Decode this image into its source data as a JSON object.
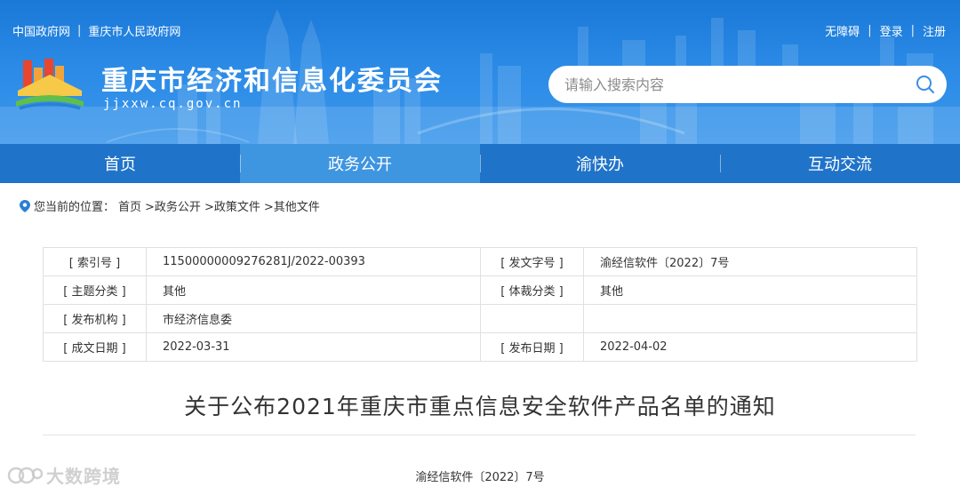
{
  "top_links": {
    "left": [
      "中国政府网",
      "重庆市人民政府网"
    ],
    "separator": "|",
    "right": [
      "无障碍",
      "登录",
      "注册"
    ]
  },
  "site": {
    "title": "重庆市经济和信息化委员会",
    "domain": "jjxxw.cq.gov.cn"
  },
  "search": {
    "placeholder": "请输入搜索内容",
    "icon": "search-icon"
  },
  "nav": {
    "items": [
      "首页",
      "政务公开",
      "渝快办",
      "互动交流"
    ],
    "active_index": 1
  },
  "breadcrumb": {
    "prefix": "您当前的位置：",
    "items": [
      "首页",
      ">政务公开",
      ">政策文件",
      ">其他文件"
    ],
    "icon": "location-pin-icon"
  },
  "meta_table": {
    "rows": [
      {
        "label1": "[ 索引号 ]",
        "value1": "11500000009276281J/2022-00393",
        "label2": "[ 发文字号 ]",
        "value2": "渝经信软件〔2022〕7号"
      },
      {
        "label1": "[ 主题分类 ]",
        "value1": "其他",
        "label2": "[ 体裁分类 ]",
        "value2": "其他"
      },
      {
        "label1": "[ 发布机构 ]",
        "value1": "市经济信息委",
        "label2": "",
        "value2": ""
      },
      {
        "label1": "[ 成文日期 ]",
        "value1": "2022-03-31",
        "label2": "[ 发布日期 ]",
        "value2": "2022-04-02"
      }
    ]
  },
  "article": {
    "title": "关于公布2021年重庆市重点信息安全软件产品名单的通知",
    "doc_number": "渝经信软件〔2022〕7号"
  },
  "watermark": {
    "text": "大数跨境"
  },
  "colors": {
    "header_blue": "#2a8ae6",
    "nav_blue": "#1f73c9",
    "nav_active": "#3e95e0"
  }
}
